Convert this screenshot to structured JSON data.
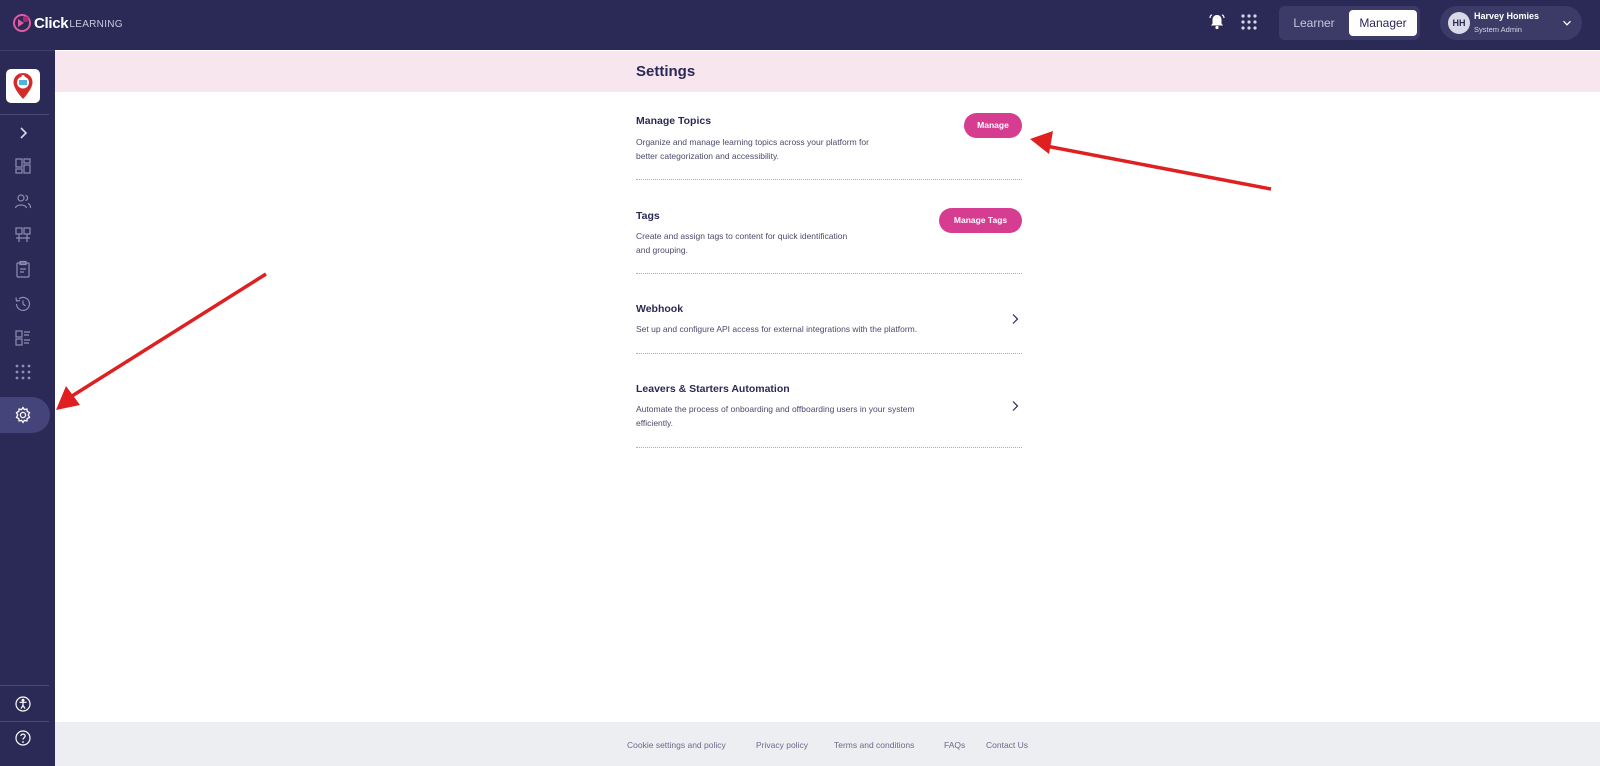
{
  "header": {
    "logo_brand": "Click",
    "logo_product": "LEARNING",
    "role_switch": {
      "learner_label": "Learner",
      "manager_label": "Manager",
      "selected": "Manager"
    },
    "user": {
      "initials": "HH",
      "name": "Harvey Homies",
      "role": "System Admin"
    }
  },
  "page": {
    "title": "Settings"
  },
  "settings_rows": [
    {
      "title": "Manage Topics",
      "description_lines": [
        "Organize and manage learning topics across your platform for",
        "better categorization and accessibility."
      ],
      "action_label": "Manage"
    },
    {
      "title": "Tags",
      "description_lines": [
        "Create and assign tags to content for quick identification",
        "and grouping."
      ],
      "action_label": "Manage Tags"
    },
    {
      "title": "Webhook",
      "description_lines": [
        "Set up and configure API access for external integrations with the platform."
      ]
    },
    {
      "title": "Leavers & Starters Automation",
      "description_lines": [
        "Automate the process of onboarding and offboarding users in your system",
        "efficiently."
      ]
    }
  ],
  "footer": {
    "links": [
      "Cookie settings and policy",
      "Privacy policy",
      "Terms and conditions",
      "FAQs",
      "Contact Us"
    ]
  },
  "colors": {
    "nav_bg": "#2b2a56",
    "accent_pink": "#d63d91",
    "title_band": "#f8e6ef",
    "annotation_arrow": "#e02020"
  },
  "icons": {
    "sidebar": [
      "expand-chevron-icon",
      "dashboard-icon",
      "users-icon",
      "courses-icon",
      "clipboard-icon",
      "history-icon",
      "reports-icon",
      "apps-grid-icon",
      "settings-gear-icon",
      "accessibility-icon",
      "help-icon"
    ],
    "header": [
      "bell-icon",
      "apps-grid-icon",
      "chevron-down-icon"
    ]
  }
}
